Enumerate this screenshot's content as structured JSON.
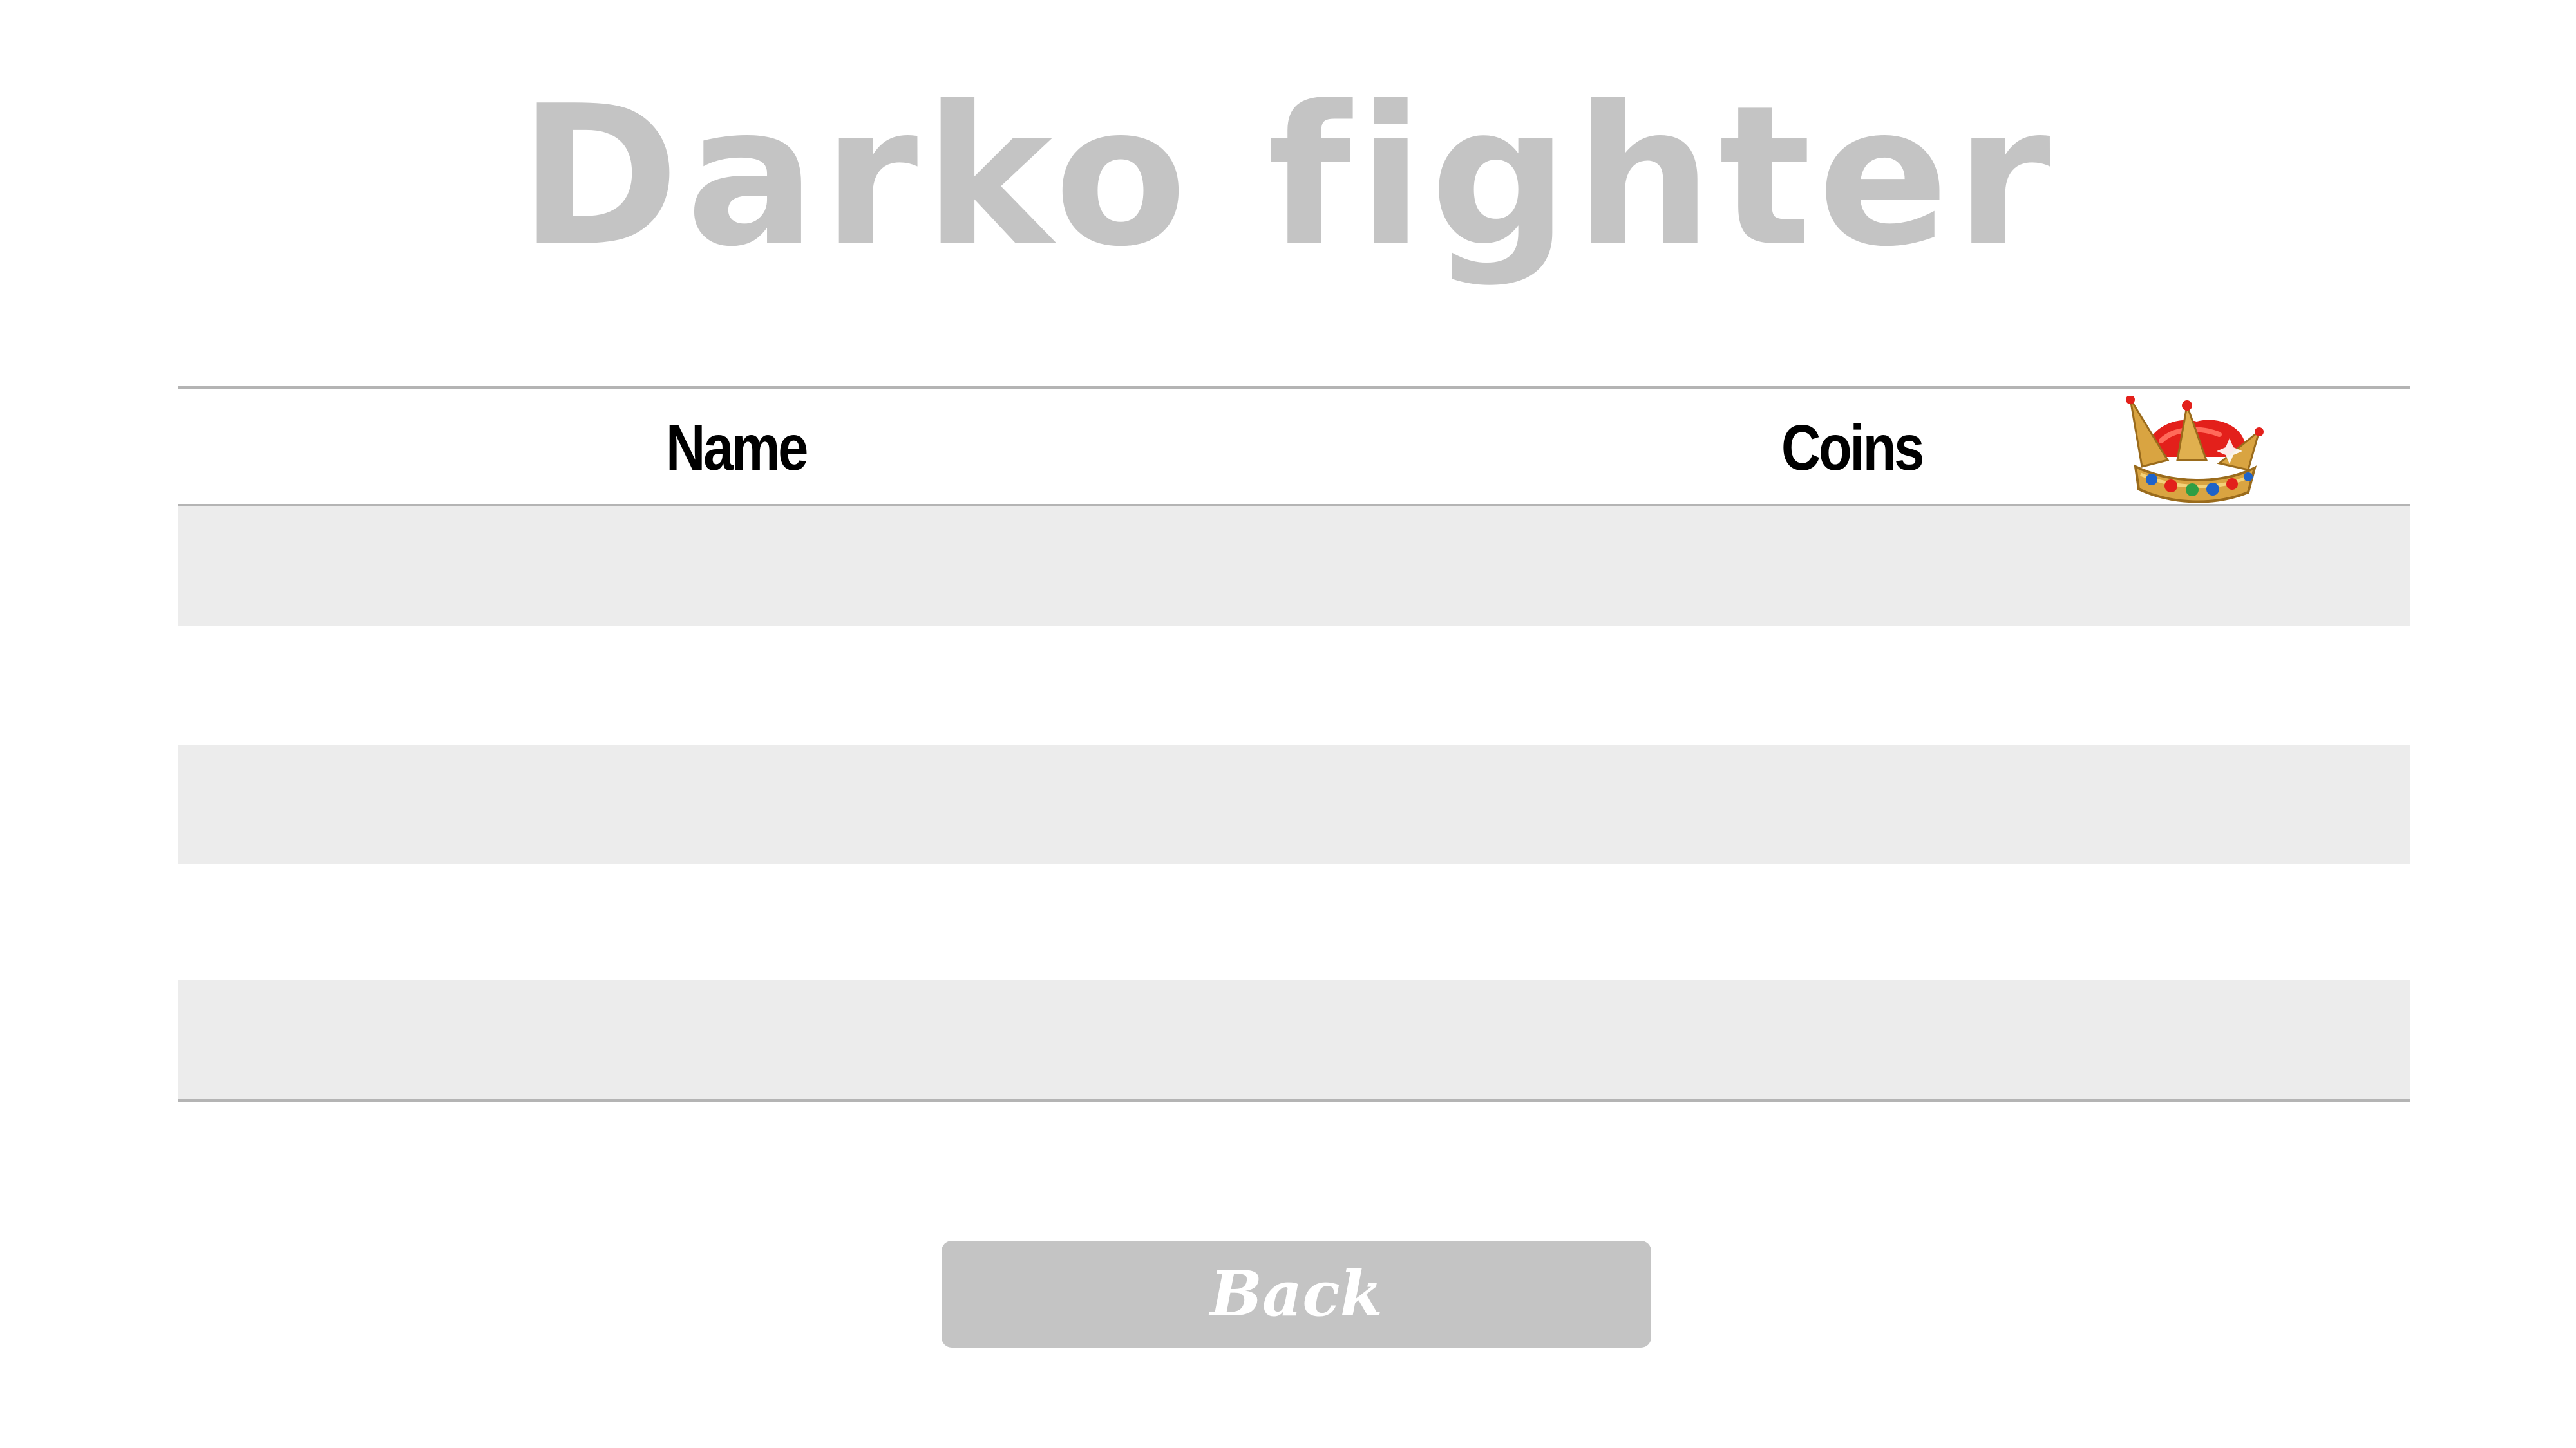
{
  "game": {
    "title": "Darko fighter"
  },
  "leaderboard": {
    "columns": {
      "name": "Name",
      "coins": "Coins"
    },
    "rows": [
      {
        "name": "",
        "coins": "",
        "shaded": true,
        "leader": true
      },
      {
        "name": "",
        "coins": "",
        "shaded": false
      },
      {
        "name": "",
        "coins": "",
        "shaded": true
      },
      {
        "name": "",
        "coins": "",
        "shaded": false
      },
      {
        "name": "",
        "coins": "",
        "shaded": true
      }
    ],
    "leader_icon": "crown-icon"
  },
  "buttons": {
    "back_label": "Back"
  },
  "colors": {
    "title": "#c4c4c4",
    "row_shaded": "#ececec",
    "rule": "#b4b4b4",
    "button_bg": "#c4c4c4",
    "button_text": "#ffffff",
    "crown_gold": "#d9a441",
    "crown_velvet": "#e3201b"
  }
}
